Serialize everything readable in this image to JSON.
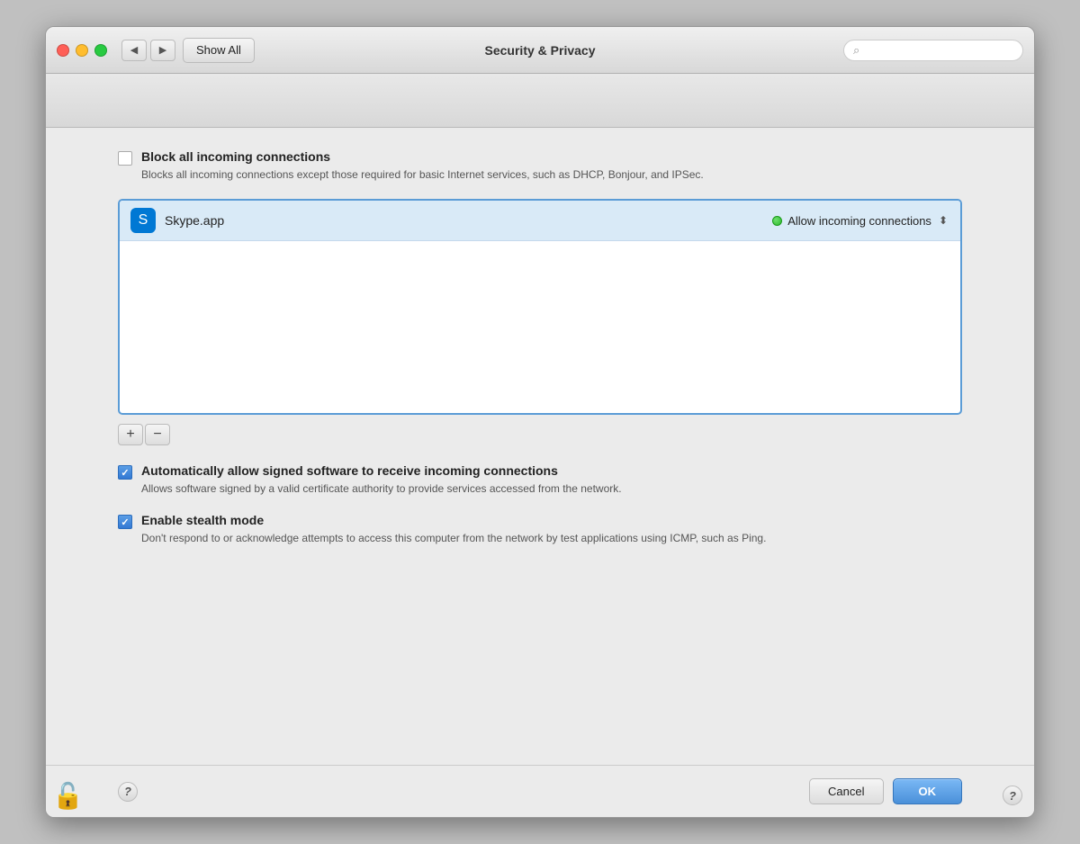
{
  "window": {
    "title": "Security & Privacy"
  },
  "toolbar": {
    "show_all_label": "Show All",
    "search_placeholder": ""
  },
  "nav": {
    "back_label": "◀",
    "forward_label": "▶"
  },
  "firewall": {
    "block_all_label": "Block all incoming connections",
    "block_all_desc": "Blocks all incoming connections except those required for basic Internet services,\nsuch as DHCP, Bonjour, and IPSec.",
    "block_all_checked": false,
    "app_list": [
      {
        "name": "Skype.app",
        "icon": "S",
        "status_text": "Allow incoming connections",
        "status_color": "green"
      }
    ],
    "add_label": "+",
    "remove_label": "−",
    "auto_allow_label": "Automatically allow signed software to receive incoming connections",
    "auto_allow_desc": "Allows software signed by a valid certificate authority to provide services accessed\nfrom the network.",
    "auto_allow_checked": true,
    "stealth_label": "Enable stealth mode",
    "stealth_desc": "Don't respond to or acknowledge attempts to access this computer from the network\nby test applications using ICMP, such as Ping.",
    "stealth_checked": true
  },
  "buttons": {
    "cancel": "Cancel",
    "ok": "OK",
    "help": "?",
    "global_help": "?"
  }
}
